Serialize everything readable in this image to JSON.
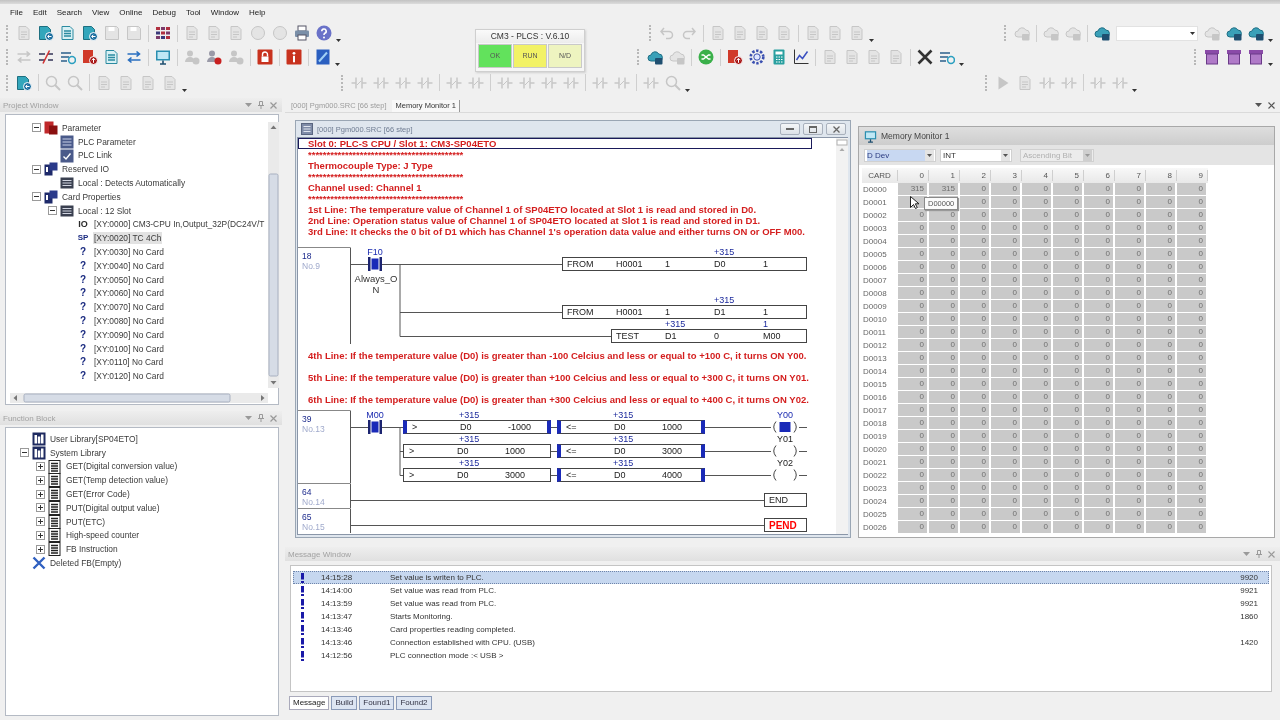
{
  "menu": [
    "File",
    "Edit",
    "Search",
    "View",
    "Online",
    "Debug",
    "Tool",
    "Window",
    "Help"
  ],
  "toolbars": [
    {
      "strips": [
        {
          "groups": [
            [
              {
                "kind": "document",
                "disabled": true
              },
              {
                "kind": "open",
                "disabled": false
              },
              {
                "kind": "list",
                "disabled": false
              },
              {
                "kind": "open",
                "disabled": false
              },
              {
                "kind": "save",
                "disabled": true
              },
              {
                "kind": "save",
                "disabled": true
              }
            ],
            [
              {
                "kind": "grid",
                "disabled": false
              }
            ],
            [
              {
                "kind": "document",
                "disabled": true
              },
              {
                "kind": "document",
                "disabled": true
              },
              {
                "kind": "document",
                "disabled": true
              },
              {
                "kind": "circle",
                "disabled": true
              },
              {
                "kind": "circle",
                "disabled": true
              },
              {
                "kind": "printer",
                "disabled": false
              },
              {
                "kind": "help",
                "disabled": false
              },
              {
                "kind": "more",
                "disabled": false
              }
            ]
          ]
        },
        {
          "groups": [
            [
              {
                "kind": "undo",
                "disabled": true
              },
              {
                "kind": "redo",
                "disabled": true
              }
            ],
            [
              {
                "kind": "document",
                "disabled": true
              },
              {
                "kind": "document",
                "disabled": true
              },
              {
                "kind": "document",
                "disabled": true
              },
              {
                "kind": "document",
                "disabled": true
              }
            ],
            [
              {
                "kind": "document",
                "disabled": true
              },
              {
                "kind": "document",
                "disabled": true
              },
              {
                "kind": "document",
                "disabled": true
              },
              {
                "kind": "more",
                "disabled": false
              }
            ]
          ]
        },
        {
          "groups": [
            [
              {
                "kind": "cloud",
                "disabled": true
              }
            ],
            [
              {
                "kind": "cloud",
                "disabled": true
              },
              {
                "kind": "cloud",
                "disabled": true
              }
            ],
            [
              {
                "kind": "cloud",
                "disabled": false
              },
              {
                "kind": "combo",
                "disabled": false
              },
              {
                "kind": "cloud",
                "disabled": true
              },
              {
                "kind": "cloud",
                "disabled": false
              },
              {
                "kind": "cloud",
                "disabled": false
              },
              {
                "kind": "more",
                "disabled": false
              }
            ]
          ]
        }
      ]
    },
    {
      "strips": [
        {
          "groups": [
            [
              {
                "kind": "swap",
                "disabled": true
              },
              {
                "kind": "cut-link",
                "disabled": false
              },
              {
                "kind": "send",
                "disabled": false
              },
              {
                "kind": "upload",
                "disabled": false
              },
              {
                "kind": "list",
                "disabled": false
              },
              {
                "kind": "swap",
                "disabled": false
              }
            ],
            [
              {
                "kind": "monitor",
                "disabled": false
              }
            ],
            [
              {
                "kind": "person",
                "disabled": true
              },
              {
                "kind": "person",
                "disabled": false
              },
              {
                "kind": "person",
                "disabled": true
              }
            ],
            [
              {
                "kind": "lock",
                "disabled": false
              }
            ],
            [
              {
                "kind": "info",
                "disabled": false
              }
            ],
            [
              {
                "kind": "book",
                "disabled": false
              },
              {
                "kind": "more",
                "disabled": false
              }
            ]
          ]
        },
        {
          "groups": [
            [
              {
                "kind": "cloud",
                "disabled": false
              },
              {
                "kind": "cloud",
                "disabled": true
              }
            ],
            [
              {
                "kind": "shuffle",
                "disabled": false
              }
            ],
            [
              {
                "kind": "upload",
                "disabled": false
              },
              {
                "kind": "gear",
                "disabled": false
              },
              {
                "kind": "calculator",
                "disabled": false
              },
              {
                "kind": "chart",
                "disabled": false
              }
            ],
            [
              {
                "kind": "document",
                "disabled": true
              },
              {
                "kind": "document",
                "disabled": true
              },
              {
                "kind": "document",
                "disabled": true
              },
              {
                "kind": "document",
                "disabled": true
              }
            ],
            [
              {
                "kind": "tools",
                "disabled": false
              },
              {
                "kind": "send",
                "disabled": false
              },
              {
                "kind": "more",
                "disabled": false
              }
            ]
          ]
        },
        {
          "groups": [
            [
              {
                "kind": "archive",
                "disabled": false
              },
              {
                "kind": "archive",
                "disabled": false
              },
              {
                "kind": "archive",
                "disabled": false
              },
              {
                "kind": "more",
                "disabled": false
              }
            ]
          ]
        }
      ]
    },
    {
      "strips": [
        {
          "groups": [
            [
              {
                "kind": "open",
                "disabled": false
              }
            ],
            [
              {
                "kind": "search",
                "disabled": true
              },
              {
                "kind": "search",
                "disabled": true
              }
            ],
            [
              {
                "kind": "document",
                "disabled": true
              },
              {
                "kind": "document",
                "disabled": true
              },
              {
                "kind": "document",
                "disabled": true
              },
              {
                "kind": "document",
                "disabled": true
              },
              {
                "kind": "more",
                "disabled": false
              }
            ]
          ]
        },
        {
          "groups": [
            [
              {
                "kind": "ladder",
                "disabled": true
              },
              {
                "kind": "ladder",
                "disabled": true
              },
              {
                "kind": "ladder",
                "disabled": true
              },
              {
                "kind": "ladder",
                "disabled": true
              }
            ],
            [
              {
                "kind": "ladder",
                "disabled": true
              },
              {
                "kind": "ladder",
                "disabled": true
              }
            ],
            [
              {
                "kind": "ladder",
                "disabled": true
              },
              {
                "kind": "ladder",
                "disabled": true
              },
              {
                "kind": "ladder",
                "disabled": true
              },
              {
                "kind": "ladder",
                "disabled": true
              }
            ],
            [
              {
                "kind": "ladder",
                "disabled": true
              },
              {
                "kind": "ladder",
                "disabled": true
              }
            ],
            [
              {
                "kind": "ladder",
                "disabled": true
              },
              {
                "kind": "search",
                "disabled": true
              },
              {
                "kind": "more",
                "disabled": false
              }
            ]
          ]
        },
        {
          "groups": [
            [
              {
                "kind": "play",
                "disabled": true
              },
              {
                "kind": "document",
                "disabled": true
              },
              {
                "kind": "ladder",
                "disabled": true
              },
              {
                "kind": "ladder",
                "disabled": true
              }
            ],
            [
              {
                "kind": "ladder",
                "disabled": true
              },
              {
                "kind": "ladder",
                "disabled": true
              },
              {
                "kind": "more",
                "disabled": false
              }
            ]
          ]
        }
      ]
    }
  ],
  "plc_status": {
    "title": "CM3 - PLCS : V.6.10",
    "indicators": [
      {
        "label": "OK",
        "color": "#62e25c"
      },
      {
        "label": "RUN",
        "color": "#f2f266"
      },
      {
        "label": "N/D",
        "color": "#eef4c0"
      }
    ]
  },
  "project_window": {
    "title": "Project Window",
    "tree": [
      {
        "label": "Parameter",
        "kind": "parameter",
        "expanded": true,
        "selected": false,
        "children": [
          {
            "label": "PLC Parameter",
            "kind": "settings",
            "selected": false
          },
          {
            "label": "PLC Link",
            "kind": "link",
            "selected": false
          }
        ]
      },
      {
        "label": "Reserved IO",
        "kind": "folder",
        "expanded": true,
        "selected": false,
        "children": [
          {
            "label": "Local : Detects Automatically",
            "kind": "rack",
            "selected": false
          }
        ]
      },
      {
        "label": "Card Properties",
        "kind": "folder",
        "expanded": true,
        "selected": false,
        "children": [
          {
            "label": "Local : 12 Slot",
            "kind": "rack",
            "expanded": true,
            "selected": false,
            "children": [
              {
                "label": "[XY:0000] CM3-CPU In,Output_32P(DC24V/T",
                "kind": "io",
                "type_label": "IO",
                "selected": false
              },
              {
                "label": "[XY:0020] TC 4Ch",
                "kind": "special",
                "type_label": "SP",
                "selected": true
              },
              {
                "label": "[XY:0030] No Card",
                "kind": "empty",
                "type_label": "?",
                "selected": false
              },
              {
                "label": "[XY:0040] No Card",
                "kind": "empty",
                "type_label": "?",
                "selected": false
              },
              {
                "label": "[XY:0050] No Card",
                "kind": "empty",
                "type_label": "?",
                "selected": false
              },
              {
                "label": "[XY:0060] No Card",
                "kind": "empty",
                "type_label": "?",
                "selected": false
              },
              {
                "label": "[XY:0070] No Card",
                "kind": "empty",
                "type_label": "?",
                "selected": false
              },
              {
                "label": "[XY:0080] No Card",
                "kind": "empty",
                "type_label": "?",
                "selected": false
              },
              {
                "label": "[XY:0090] No Card",
                "kind": "empty",
                "type_label": "?",
                "selected": false
              },
              {
                "label": "[XY:0100] No Card",
                "kind": "empty",
                "type_label": "?",
                "selected": false
              },
              {
                "label": "[XY:0110] No Card",
                "kind": "empty",
                "type_label": "?",
                "selected": false
              },
              {
                "label": "[XY:0120] No Card",
                "kind": "empty",
                "type_label": "?",
                "selected": false
              }
            ]
          }
        ]
      }
    ]
  },
  "function_block": {
    "title": "Function Block",
    "tree": [
      {
        "label": "User Library[SP04ETO]",
        "kind": "library",
        "selected": false
      },
      {
        "label": "System Library",
        "kind": "library",
        "expanded": true,
        "selected": false,
        "children": [
          {
            "label": "GET(Digital conversion value)",
            "kind": "block",
            "expanded": false,
            "selected": false
          },
          {
            "label": "GET(Temp detection value)",
            "kind": "block",
            "expanded": false,
            "selected": false
          },
          {
            "label": "GET(Error Code)",
            "kind": "block",
            "expanded": false,
            "selected": false
          },
          {
            "label": "PUT(Digital output value)",
            "kind": "block",
            "expanded": false,
            "selected": false
          },
          {
            "label": "PUT(ETC)",
            "kind": "block",
            "expanded": false,
            "selected": false
          },
          {
            "label": "High-speed counter",
            "kind": "block",
            "expanded": false,
            "selected": false
          },
          {
            "label": "FB Instruction",
            "kind": "block",
            "expanded": false,
            "selected": false
          }
        ]
      },
      {
        "label": "Deleted FB(Empty)",
        "kind": "deleted",
        "selected": false
      }
    ]
  },
  "document_tabs": [
    {
      "label": "[000] Pgm000.SRC [66 step]",
      "selected": false
    },
    {
      "label": "Memory Monitor 1",
      "selected": true
    }
  ],
  "editor": {
    "title": "[000] Pgm000.SRC [66 step]",
    "sections": [
      {
        "kind": "comment",
        "lines": [
          {
            "text": "Slot 0: PLC-S CPU / Slot 1: CM3-SP04ETO",
            "selected": true
          },
          {
            "text": "******************************************",
            "selected": false
          },
          {
            "text": "Thermocouple Type: J Type",
            "selected": false
          },
          {
            "text": "******************************************",
            "selected": false
          },
          {
            "text": "Channel used: Channel 1",
            "selected": false
          },
          {
            "text": "******************************************",
            "selected": false
          },
          {
            "text": "1st Line: The temperature value of Channel 1 of SP04ETO located at Slot 1 is read and stored in D0.",
            "selected": false
          },
          {
            "text": "2nd Line: Operation status value of Channel 1 of SP04ETO located at Slot 1 is read and stored in D1.",
            "selected": false
          },
          {
            "text": "3rd Line: It checks the 0 bit of D1 which has Channel 1's operation data value and either turns ON or OFF M00.",
            "selected": false
          }
        ]
      },
      {
        "kind": "rung",
        "step": "18",
        "number": "No.9",
        "rows": [
          [
            {
              "kind": "contact",
              "device": "F10",
              "comment": "Always_ON",
              "on": true
            },
            {
              "kind": "instruction",
              "fields": [
                {
                  "text": "FROM"
                },
                {
                  "text": "H0001"
                },
                {
                  "text": "1"
                },
                {
                  "text": "D0",
                  "monitor": "+315"
                },
                {
                  "text": "1"
                }
              ]
            }
          ],
          [
            "",
            {
              "kind": "instruction",
              "fields": [
                {
                  "text": "FROM"
                },
                {
                  "text": "H0001"
                },
                {
                  "text": "1"
                },
                {
                  "text": "D1",
                  "monitor": "+315"
                },
                {
                  "text": "1"
                }
              ]
            }
          ],
          [
            "",
            {
              "kind": "instruction",
              "fields": [
                {
                  "text": "TEST"
                },
                {
                  "text": "D1",
                  "monitor": "+315"
                },
                {
                  "text": "0"
                },
                {
                  "text": "M00",
                  "monitor": "1"
                }
              ]
            }
          ]
        ]
      },
      {
        "kind": "comment",
        "lines": [
          {
            "text": "4th Line: If the temperature value (D0) is greater than -100 Celcius and less or equal to +100 C, it turns ON Y00.",
            "selected": false
          }
        ]
      },
      {
        "kind": "comment",
        "lines": [
          {
            "text": "5th Line: If the temperature value (D0) is greater than +100 Celcius and less or equal to +300 C, it turns ON Y01.",
            "selected": false
          }
        ]
      },
      {
        "kind": "comment",
        "lines": [
          {
            "text": "6th Line: If the temperature value (D0) is greater than +300 Celcius and less or equal to +400 C, it turns ON Y02.",
            "selected": false
          }
        ]
      },
      {
        "kind": "rung",
        "step": "39",
        "number": "No.13",
        "rows": [
          [
            {
              "kind": "contact",
              "device": "M00",
              "on": true
            },
            {
              "kind": "compare",
              "on": true,
              "fields": [
                {
                  "text": ">"
                },
                {
                  "text": "D0",
                  "monitor": "+315"
                },
                {
                  "text": "-1000"
                }
              ]
            },
            {
              "kind": "compare",
              "on": true,
              "fields": [
                {
                  "text": "<="
                },
                {
                  "text": "D0",
                  "monitor": "+315"
                },
                {
                  "text": "1000"
                }
              ]
            },
            {
              "kind": "coil",
              "device": "Y00",
              "on": true
            }
          ],
          [
            "",
            {
              "kind": "compare",
              "on": false,
              "fields": [
                {
                  "text": ">"
                },
                {
                  "text": "D0",
                  "monitor": "+315"
                },
                {
                  "text": "1000"
                }
              ]
            },
            {
              "kind": "compare",
              "on": true,
              "fields": [
                {
                  "text": "<="
                },
                {
                  "text": "D0",
                  "monitor": "+315"
                },
                {
                  "text": "3000"
                }
              ]
            },
            {
              "kind": "coil",
              "device": "Y01",
              "on": false
            }
          ],
          [
            "",
            {
              "kind": "compare",
              "on": false,
              "fields": [
                {
                  "text": ">"
                },
                {
                  "text": "D0",
                  "monitor": "+315"
                },
                {
                  "text": "3000"
                }
              ]
            },
            {
              "kind": "compare",
              "on": true,
              "fields": [
                {
                  "text": "<="
                },
                {
                  "text": "D0",
                  "monitor": "+315"
                },
                {
                  "text": "4000"
                }
              ]
            },
            {
              "kind": "coil",
              "device": "Y02",
              "on": false
            }
          ]
        ]
      },
      {
        "kind": "rung",
        "step": "64",
        "number": "No.14",
        "rows": [
          [
            {
              "kind": "instruction",
              "fields": [
                {
                  "text": "END"
                }
              ]
            }
          ]
        ]
      },
      {
        "kind": "rung",
        "step": "65",
        "number": "No.15",
        "rows": [
          [
            {
              "kind": "instruction",
              "color": "#ff0000",
              "fields": [
                {
                  "text": "PEND"
                }
              ]
            }
          ]
        ]
      }
    ]
  },
  "memory_monitor": {
    "title": "Memory Monitor 1",
    "device": {
      "value": "D Dev",
      "focused": true
    },
    "type": {
      "value": "INT",
      "disabled": false
    },
    "order": {
      "value": "Ascending Bit",
      "disabled": true
    },
    "tooltip": "D00000",
    "columns": [
      "CARD",
      "0",
      "1",
      "2",
      "3",
      "4",
      "5",
      "6",
      "7",
      "8",
      "9"
    ],
    "rows": [
      {
        "address": "D0000",
        "values": [
          "315",
          "315",
          "0",
          "0",
          "0",
          "0",
          "0",
          "0",
          "0",
          "0"
        ]
      },
      {
        "address": "D0001",
        "values": [
          "0",
          "0",
          "0",
          "0",
          "0",
          "0",
          "0",
          "0"
        ]
      },
      {
        "address": "D0002",
        "values": [
          "0",
          "0",
          "0",
          "0",
          "0",
          "0",
          "0",
          "0",
          "0",
          "0"
        ]
      },
      {
        "address": "D0003",
        "values": [
          "0",
          "0",
          "0",
          "0",
          "0",
          "0",
          "0",
          "0",
          "0",
          "0"
        ]
      },
      {
        "address": "D0004",
        "values": [
          "0",
          "0",
          "0",
          "0",
          "0",
          "0",
          "0",
          "0",
          "0",
          "0"
        ]
      },
      {
        "address": "D0005",
        "values": [
          "0",
          "0",
          "0",
          "0",
          "0",
          "0",
          "0",
          "0",
          "0",
          "0"
        ]
      },
      {
        "address": "D0006",
        "values": [
          "0",
          "0",
          "0",
          "0",
          "0",
          "0",
          "0",
          "0",
          "0",
          "0"
        ]
      },
      {
        "address": "D0007",
        "values": [
          "0",
          "0",
          "0",
          "0",
          "0",
          "0",
          "0",
          "0",
          "0",
          "0"
        ]
      },
      {
        "address": "D0008",
        "values": [
          "0",
          "0",
          "0",
          "0",
          "0",
          "0",
          "0",
          "0",
          "0",
          "0"
        ]
      },
      {
        "address": "D0009",
        "values": [
          "0",
          "0",
          "0",
          "0",
          "0",
          "0",
          "0",
          "0",
          "0",
          "0"
        ]
      },
      {
        "address": "D0010",
        "values": [
          "0",
          "0",
          "0",
          "0",
          "0",
          "0",
          "0",
          "0",
          "0",
          "0"
        ]
      },
      {
        "address": "D0011",
        "values": [
          "0",
          "0",
          "0",
          "0",
          "0",
          "0",
          "0",
          "0",
          "0",
          "0"
        ]
      },
      {
        "address": "D0012",
        "values": [
          "0",
          "0",
          "0",
          "0",
          "0",
          "0",
          "0",
          "0",
          "0",
          "0"
        ]
      },
      {
        "address": "D0013",
        "values": [
          "0",
          "0",
          "0",
          "0",
          "0",
          "0",
          "0",
          "0",
          "0",
          "0"
        ]
      },
      {
        "address": "D0014",
        "values": [
          "0",
          "0",
          "0",
          "0",
          "0",
          "0",
          "0",
          "0",
          "0",
          "0"
        ]
      },
      {
        "address": "D0015",
        "values": [
          "0",
          "0",
          "0",
          "0",
          "0",
          "0",
          "0",
          "0",
          "0",
          "0"
        ]
      },
      {
        "address": "D0016",
        "values": [
          "0",
          "0",
          "0",
          "0",
          "0",
          "0",
          "0",
          "0",
          "0",
          "0"
        ]
      },
      {
        "address": "D0017",
        "values": [
          "0",
          "0",
          "0",
          "0",
          "0",
          "0",
          "0",
          "0",
          "0",
          "0"
        ]
      },
      {
        "address": "D0018",
        "values": [
          "0",
          "0",
          "0",
          "0",
          "0",
          "0",
          "0",
          "0",
          "0",
          "0"
        ]
      },
      {
        "address": "D0019",
        "values": [
          "0",
          "0",
          "0",
          "0",
          "0",
          "0",
          "0",
          "0",
          "0",
          "0"
        ]
      },
      {
        "address": "D0020",
        "values": [
          "0",
          "0",
          "0",
          "0",
          "0",
          "0",
          "0",
          "0",
          "0",
          "0"
        ]
      },
      {
        "address": "D0021",
        "values": [
          "0",
          "0",
          "0",
          "0",
          "0",
          "0",
          "0",
          "0",
          "0",
          "0"
        ]
      },
      {
        "address": "D0022",
        "values": [
          "0",
          "0",
          "0",
          "0",
          "0",
          "0",
          "0",
          "0",
          "0",
          "0"
        ]
      },
      {
        "address": "D0023",
        "values": [
          "0",
          "0",
          "0",
          "0",
          "0",
          "0",
          "0",
          "0",
          "0",
          "0"
        ]
      },
      {
        "address": "D0024",
        "values": [
          "0",
          "0",
          "0",
          "0",
          "0",
          "0",
          "0",
          "0",
          "0",
          "0"
        ]
      },
      {
        "address": "D0025",
        "values": [
          "0",
          "0",
          "0",
          "0",
          "0",
          "0",
          "0",
          "0",
          "0",
          "0"
        ]
      },
      {
        "address": "D0026",
        "values": [
          "0",
          "0",
          "0",
          "0",
          "0",
          "0",
          "0",
          "0",
          "0",
          "0"
        ]
      }
    ]
  },
  "message_window": {
    "title": "Message Window",
    "messages": [
      {
        "time": "14:15:28",
        "text": "Set value is writen to PLC.",
        "code": "9920",
        "selected": true
      },
      {
        "time": "14:14:00",
        "text": "Set value was read from PLC.",
        "code": "9921",
        "selected": false
      },
      {
        "time": "14:13:59",
        "text": "Set value was read from PLC.",
        "code": "9921",
        "selected": false
      },
      {
        "time": "14:13:47",
        "text": "Starts Monitoring.",
        "code": "1860",
        "selected": false
      },
      {
        "time": "14:13:46",
        "text": "Card properties reading completed.",
        "selected": false
      },
      {
        "time": "14:13:46",
        "text": "Connection established with CPU. (USB)",
        "code": "1420",
        "selected": false
      },
      {
        "time": "14:12:56",
        "text": "PLC connection mode :< USB >",
        "selected": false
      }
    ],
    "tabs": [
      {
        "label": "Message",
        "selected": true
      },
      {
        "label": "Build",
        "selected": false
      },
      {
        "label": "Found1",
        "selected": false
      },
      {
        "label": "Found2",
        "selected": false
      }
    ]
  }
}
